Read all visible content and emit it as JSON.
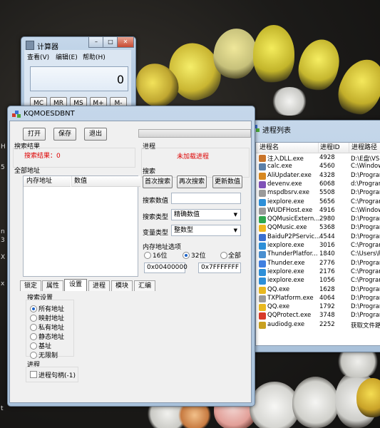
{
  "calculator": {
    "title": "计算器",
    "menu": [
      "查看(V)",
      "编辑(E)",
      "帮助(H)"
    ],
    "display": "0",
    "memory_buttons": [
      "MC",
      "MR",
      "MS",
      "M+",
      "M-"
    ],
    "window_buttons": [
      "–",
      "□",
      "✕"
    ]
  },
  "main": {
    "title": "KQMOESDBNT",
    "window_buttons": [
      "–",
      "□",
      "✕"
    ],
    "toolbar": {
      "open": "打开",
      "save": "保存",
      "exit": "退出"
    },
    "results": {
      "group": "搜索结果",
      "text": "搜索结果：0"
    },
    "addresses": {
      "group": "全部地址",
      "columns": [
        "内存地址",
        "数值"
      ]
    },
    "process": {
      "group": "进程",
      "status": "未加载进程"
    },
    "search": {
      "group": "搜索",
      "buttons": [
        "首次搜索",
        "再次搜索",
        "更新数值"
      ],
      "value_label": "搜索数值",
      "value": "",
      "type_label": "搜索类型",
      "type_value": "精确数值",
      "vartype_label": "变量类型",
      "vartype_value": "整数型"
    },
    "memory": {
      "group": "内存地址选项",
      "options": [
        "16位",
        "32位",
        "全部"
      ],
      "selected": "32位",
      "start": "0x00400000",
      "end": "0x7FFFFFFF"
    },
    "tabs": [
      "锁定",
      "属性",
      "设置",
      "进程",
      "模块",
      "汇编"
    ],
    "active_tab": "设置",
    "settings": {
      "group": "搜索设置",
      "options": [
        "所有地址",
        "映射地址",
        "私有地址",
        "静态地址",
        "基址",
        "无限制"
      ],
      "selected": "所有地址"
    },
    "process_box": {
      "group": "进程",
      "checkbox": "进程句柄(-1)"
    }
  },
  "process_list": {
    "title": "进程列表",
    "columns": [
      "进程名",
      "进程ID",
      "进程路径"
    ],
    "rows": [
      {
        "name": "注入DLL.exe",
        "pid": "4928",
        "path": "D:\\E盘\\VS",
        "color": "#c9742a"
      },
      {
        "name": "calc.exe",
        "pid": "4560",
        "path": "C:\\Window",
        "color": "#5b7fa8"
      },
      {
        "name": "AliUpdater.exe",
        "pid": "4328",
        "path": "D:\\Program",
        "color": "#d88820"
      },
      {
        "name": "devenv.exe",
        "pid": "6068",
        "path": "d:\\Program",
        "color": "#7f52b8"
      },
      {
        "name": "mspdbsrv.exe",
        "pid": "5508",
        "path": "D:\\Program",
        "color": "#9a9a9a"
      },
      {
        "name": "iexplore.exe",
        "pid": "5656",
        "path": "C:\\Program",
        "color": "#2d8fd8"
      },
      {
        "name": "WUDFHost.exe",
        "pid": "4916",
        "path": "C:\\Window",
        "color": "#9a9a9a"
      },
      {
        "name": "QQMusicExtern...",
        "pid": "2980",
        "path": "D:\\Program",
        "color": "#2fa84f"
      },
      {
        "name": "QQMusic.exe",
        "pid": "5368",
        "path": "D:\\Program",
        "color": "#f0b720"
      },
      {
        "name": "BaiduP2PServic...",
        "pid": "4544",
        "path": "D:\\Program",
        "color": "#3a6fd0"
      },
      {
        "name": "iexplore.exe",
        "pid": "3016",
        "path": "C:\\Program",
        "color": "#2d8fd8"
      },
      {
        "name": "ThunderPlatfor...",
        "pid": "1840",
        "path": "C:\\Users\\P",
        "color": "#4a8fd0"
      },
      {
        "name": "Thunder.exe",
        "pid": "2776",
        "path": "D:\\Program",
        "color": "#3f7fe0"
      },
      {
        "name": "iexplore.exe",
        "pid": "2176",
        "path": "C:\\Program",
        "color": "#2d8fd8"
      },
      {
        "name": "iexplore.exe",
        "pid": "1056",
        "path": "C:\\Program",
        "color": "#2d8fd8"
      },
      {
        "name": "QQ.exe",
        "pid": "1628",
        "path": "D:\\Program",
        "color": "#e8b820"
      },
      {
        "name": "TXPlatform.exe",
        "pid": "4064",
        "path": "D:\\Program",
        "color": "#9a9a9a"
      },
      {
        "name": "QQ.exe",
        "pid": "1792",
        "path": "D:\\Program",
        "color": "#e8b820"
      },
      {
        "name": "QQProtect.exe",
        "pid": "3748",
        "path": "D:\\Program",
        "color": "#d83a2a"
      },
      {
        "name": "audiodg.exe",
        "pid": "2252",
        "path": "获取文件路",
        "color": "#c8a020"
      }
    ]
  },
  "desktop_edge": [
    "H",
    "5",
    "n",
    "3",
    "X",
    "x",
    "t"
  ]
}
